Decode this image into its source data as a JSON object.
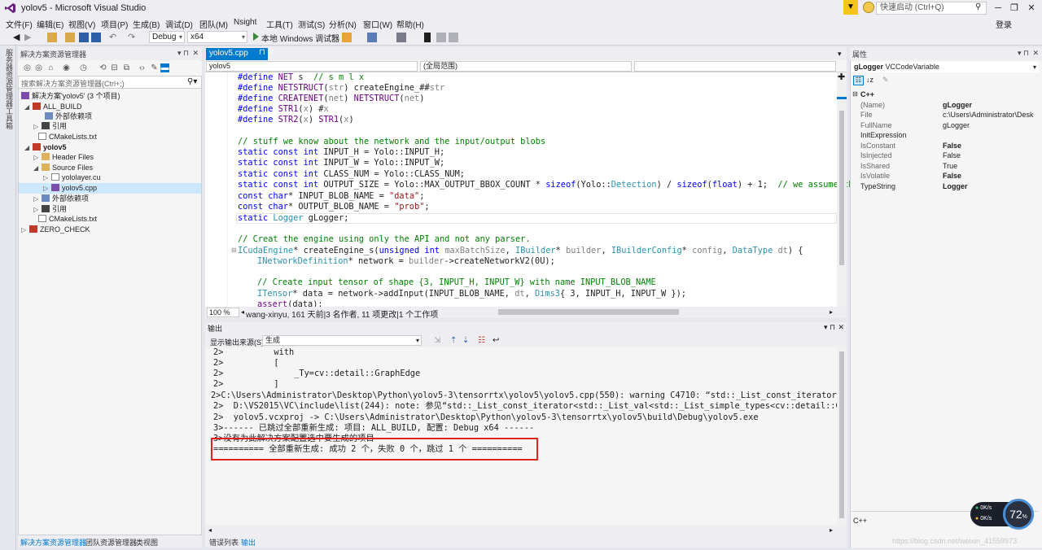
{
  "window": {
    "title": "yolov5 - Microsoft Visual Studio",
    "notification_count": "▼",
    "quick_launch_placeholder": "快速启动 (Ctrl+Q)",
    "login": "登录"
  },
  "menu": [
    "文件(F)",
    "编辑(E)",
    "视图(V)",
    "项目(P)",
    "生成(B)",
    "调试(D)",
    "团队(M)",
    "Nsight",
    "工具(T)",
    "测试(S)",
    "分析(N)",
    "窗口(W)",
    "帮助(H)"
  ],
  "toolbar": {
    "config": "Debug",
    "platform": "x64",
    "run_label": "本地 Windows 调试器"
  },
  "left_tabs": [
    "服务器资源管理器",
    "工具箱"
  ],
  "solution_explorer": {
    "title": "解决方案资源管理器",
    "search_placeholder": "搜索解决方案资源管理器(Ctrl+;)",
    "tree": [
      {
        "label": "解决方案'yolov5' (3 个项目)",
        "twisty": "",
        "bold": false
      },
      {
        "label": "ALL_BUILD",
        "twisty": "◢",
        "bold": false
      },
      {
        "label": "外部依赖项",
        "twisty": "",
        "bold": false
      },
      {
        "label": "引用",
        "twisty": "▷",
        "bold": false
      },
      {
        "label": "CMakeLists.txt",
        "twisty": "",
        "bold": false
      },
      {
        "label": "yolov5",
        "twisty": "◢",
        "bold": true
      },
      {
        "label": "Header Files",
        "twisty": "▷",
        "bold": false
      },
      {
        "label": "Source Files",
        "twisty": "◢",
        "bold": false
      },
      {
        "label": "yololayer.cu",
        "twisty": "▷",
        "bold": false
      },
      {
        "label": "yolov5.cpp",
        "twisty": "▷",
        "bold": false
      },
      {
        "label": "外部依赖项",
        "twisty": "▷",
        "bold": false
      },
      {
        "label": "引用",
        "twisty": "▷",
        "bold": false
      },
      {
        "label": "CMakeLists.txt",
        "twisty": "",
        "bold": false
      },
      {
        "label": "ZERO_CHECK",
        "twisty": "▷",
        "bold": false
      }
    ],
    "bottom_tabs": [
      "解决方案资源管理器",
      "团队资源管理器",
      "类视图"
    ]
  },
  "editor": {
    "file_tab": "yolov5.cpp",
    "nav_project": "yolov5",
    "nav_scope": "(全局范围)",
    "zoom": "100 %",
    "codelens": "wang-xinyu, 161 天前|3 名作者, 11 项更改|1 个工作项"
  },
  "output": {
    "title": "输出",
    "source_label": "显示输出来源(S):",
    "source_value": "生成",
    "lines": [
      "2>          with",
      "2>          [",
      "2>              _Ty=cv::detail::GraphEdge",
      "2>          ]",
      "2>C:\\Users\\Administrator\\Desktop\\Python\\yolov5-3\\tensorrtx\\yolov5\\yolov5.cpp(550): warning C4710: “std::_List_const_iterator<std::_List_",
      "2>  D:\\VS2015\\VC\\include\\list(244): note: 参见“std::_List_const_iterator<std::_List_val<std::_List_simple_types<cv::detail::GraphEdge>>>:",
      "2>  yolov5.vcxproj -> C:\\Users\\Administrator\\Desktop\\Python\\yolov5-3\\tensorrtx\\yolov5\\build\\Debug\\yolov5.exe",
      "3>------ 已跳过全部重新生成: 项目: ALL_BUILD, 配置: Debug x64 ------",
      "3>没有为此解决方案配置选中要生成的项目",
      "========== 全部重新生成: 成功 2 个，失败 0 个，跳过 1 个 =========="
    ],
    "bottom_tabs": [
      "错误列表",
      "输出"
    ]
  },
  "properties": {
    "title": "属性",
    "object_name": "gLogger",
    "object_type": "VCCodeVariable",
    "category": "C++",
    "rows": [
      {
        "name": "(Name)",
        "value": "gLogger"
      },
      {
        "name": "File",
        "value": "c:\\Users\\Administrator\\Desk"
      },
      {
        "name": "FullName",
        "value": "gLogger"
      },
      {
        "name": "InitExpression",
        "value": ""
      },
      {
        "name": "IsConstant",
        "value": "False"
      },
      {
        "name": "IsInjected",
        "value": "False"
      },
      {
        "name": "IsShared",
        "value": "True"
      },
      {
        "name": "IsVolatile",
        "value": "False"
      },
      {
        "name": "TypeString",
        "value": "Logger"
      }
    ],
    "description": "C++"
  },
  "netspeed": {
    "percent": "72",
    "percent_sign": "%",
    "up": "0K/s",
    "down": "0K/s"
  },
  "watermark": "https://blog.csdn.net/weixin_41559973",
  "colors": {
    "accent": "#007acc",
    "highlight_box": "#e02020"
  }
}
